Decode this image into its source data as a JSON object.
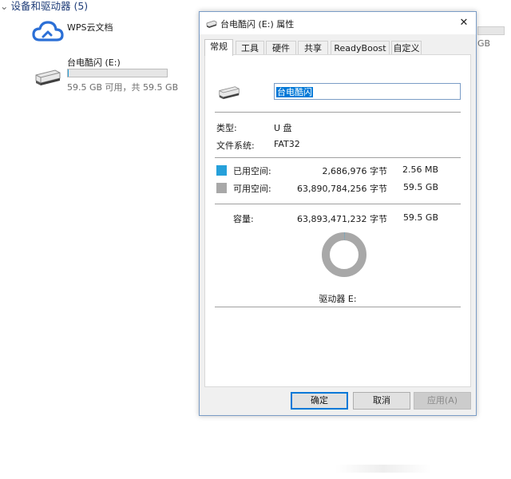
{
  "explorer": {
    "section_title": "设备和驱动器 (5)",
    "wps_label": "WPS云文档",
    "drive": {
      "name": "台电酷闪 (E:)",
      "space_text": "59.5 GB 可用，共 59.5 GB",
      "used_fraction": 0.01
    },
    "right_partial_text": "GB"
  },
  "dialog": {
    "title": "台电酷闪 (E:) 属性",
    "close_glyph": "✕",
    "tabs": [
      "常规",
      "工具",
      "硬件",
      "共享",
      "ReadyBoost",
      "自定义"
    ],
    "active_tab": 0,
    "name_value": "台电酷闪",
    "type_label": "类型:",
    "type_value": "U 盘",
    "fs_label": "文件系统:",
    "fs_value": "FAT32",
    "used_label": "已用空间:",
    "used_bytes": "2,686,976 字节",
    "used_size": "2.56 MB",
    "free_label": "可用空间:",
    "free_bytes": "63,890,784,256 字节",
    "free_size": "59.5 GB",
    "capacity_label": "容量:",
    "capacity_bytes": "63,893,471,232 字节",
    "capacity_size": "59.5 GB",
    "drive_label": "驱动器 E:",
    "used_fraction": 4e-05,
    "buttons": {
      "ok": "确定",
      "cancel": "取消",
      "apply": "应用(A)"
    }
  },
  "colors": {
    "used": "#26a0da",
    "free": "#a8a8a8",
    "accent": "#0078d7"
  }
}
